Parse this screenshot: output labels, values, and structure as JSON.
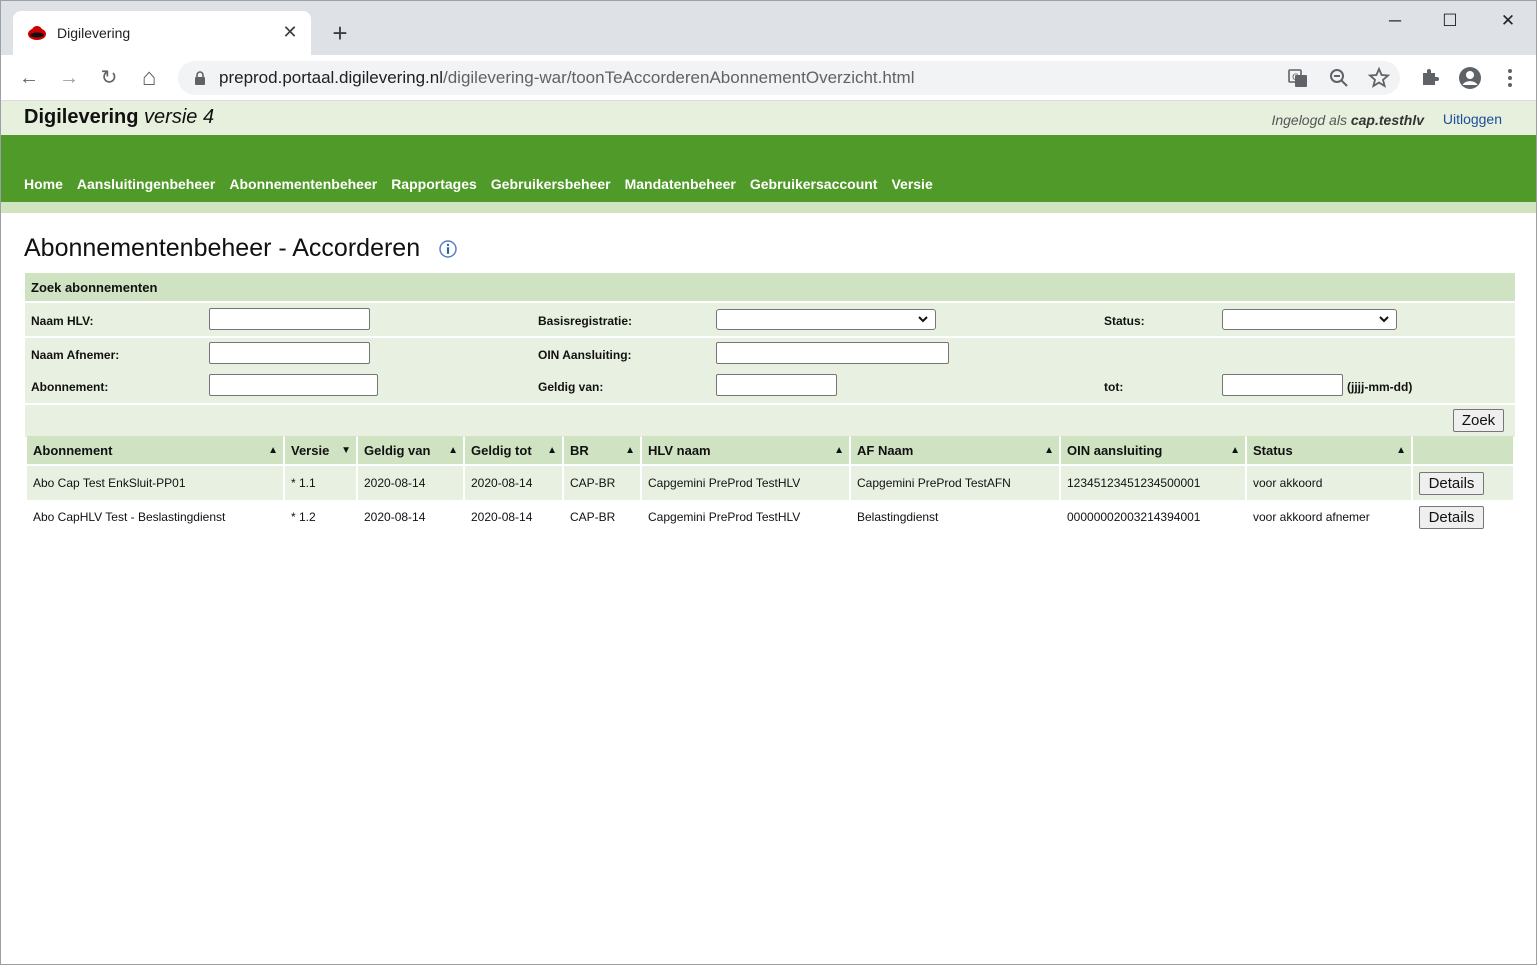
{
  "browser": {
    "tab_title": "Digilevering",
    "tab_close": "✕",
    "new_tab": "+",
    "url_host": "preprod.portaal.digilevering.nl",
    "url_path": "/digilevering-war/toonTeAccorderenAbonnementOverzicht.html",
    "window_controls": {
      "minimize": "─",
      "maximize": "☐",
      "close": "✕"
    },
    "nav": {
      "back": "←",
      "forward": "→",
      "reload": "↻",
      "home": "⌂"
    },
    "icons": {
      "translate": "translate-icon",
      "zoom": "zoom-out-icon",
      "star": "star-icon",
      "extensions": "puzzle-icon",
      "profile": "account-icon",
      "menu": "more-vertical-icon"
    }
  },
  "site": {
    "title": "Digilevering",
    "version": "versie 4",
    "login_prefix": "Ingelogd als",
    "login_user": "cap.testhlv",
    "logout": "Uitloggen",
    "brand_green": "#4f9a28"
  },
  "nav": {
    "items": [
      "Home",
      "Aansluitingenbeheer",
      "Abonnementenbeheer",
      "Rapportages",
      "Gebruikersbeheer",
      "Mandatenbeheer",
      "Gebruikersaccount",
      "Versie"
    ]
  },
  "page": {
    "title": "Abonnementenbeheer - Accorderen"
  },
  "search": {
    "heading": "Zoek abonnementen",
    "labels": {
      "naam_hlv": "Naam HLV:",
      "basisregistratie": "Basisregistratie:",
      "status": "Status:",
      "naam_afnemer": "Naam Afnemer:",
      "oin_aansluiting": "OIN Aansluiting:",
      "abonnement": "Abonnement:",
      "geldig_van": "Geldig van:",
      "tot": "tot:",
      "date_hint": "(jjjj-mm-dd)"
    },
    "values": {
      "naam_hlv": "",
      "naam_afnemer": "",
      "abonnement": "",
      "oin_aansluiting": "",
      "geldig_van": "",
      "tot": "",
      "basisregistratie": "",
      "status": ""
    },
    "submit": "Zoek"
  },
  "table": {
    "columns": [
      {
        "label": "Abonnement",
        "sort": "▲"
      },
      {
        "label": "Versie",
        "sort": "▼"
      },
      {
        "label": "Geldig van",
        "sort": "▲"
      },
      {
        "label": "Geldig tot",
        "sort": "▲"
      },
      {
        "label": "BR",
        "sort": "▲"
      },
      {
        "label": "HLV naam",
        "sort": "▲"
      },
      {
        "label": "AF Naam",
        "sort": "▲"
      },
      {
        "label": "OIN aansluiting",
        "sort": "▲"
      },
      {
        "label": "Status",
        "sort": "▲"
      },
      {
        "label": "",
        "sort": ""
      }
    ],
    "rows": [
      {
        "abonnement": "Abo Cap Test EnkSluit-PP01",
        "versie": "* 1.1",
        "geldig_van": "2020-08-14",
        "geldig_tot": "2020-08-14",
        "br": "CAP-BR",
        "hlv_naam": "Capgemini PreProd TestHLV",
        "af_naam": "Capgemini PreProd TestAFN",
        "oin": "12345123451234500001",
        "status": "voor akkoord",
        "action": "Details"
      },
      {
        "abonnement": "Abo CapHLV Test - Beslastingdienst",
        "versie": "* 1.2",
        "geldig_van": "2020-08-14",
        "geldig_tot": "2020-08-14",
        "br": "CAP-BR",
        "hlv_naam": "Capgemini PreProd TestHLV",
        "af_naam": "Belastingdienst",
        "oin": "00000002003214394001",
        "status": "voor akkoord afnemer",
        "action": "Details"
      }
    ]
  }
}
